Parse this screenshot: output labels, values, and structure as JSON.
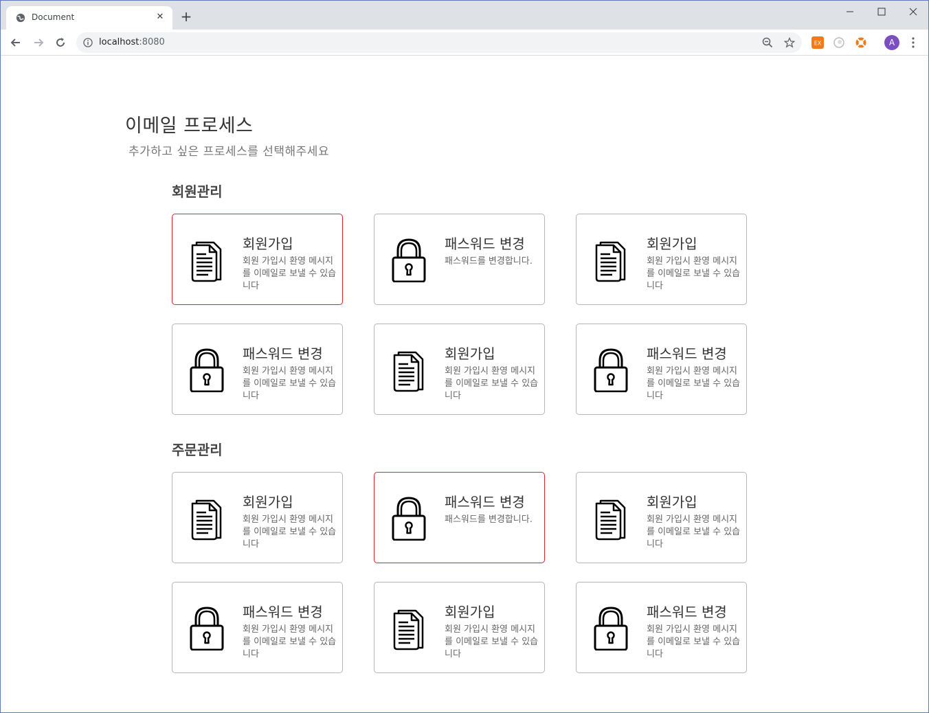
{
  "browser": {
    "tab_title": "Document",
    "url_host": "localhost",
    "url_port": ":8080",
    "avatar_letter": "A",
    "accent": "#7b4fc0"
  },
  "page": {
    "title": "이메일 프로세스",
    "subtitle": "추가하고 싶은 프로세스를 선택해주세요"
  },
  "sections": [
    {
      "title": "회원관리",
      "cards": [
        {
          "title": "회원가입",
          "desc": "회원 가입시 환영 메시지를 이메일로 보낼 수 있습니다",
          "icon": "document-icon",
          "selected": true
        },
        {
          "title": "패스워드 변경",
          "desc": "패스워드를 변경합니다.",
          "icon": "lock-icon",
          "selected": false
        },
        {
          "title": "회원가입",
          "desc": "회원 가입시 환영 메시지를 이메일로 보낼 수 있습니다",
          "icon": "document-icon",
          "selected": false
        },
        {
          "title": "패스워드 변경",
          "desc": "회원 가입시 환영 메시지를 이메일로 보낼 수 있습니다",
          "icon": "lock-icon",
          "selected": false
        },
        {
          "title": "회원가입",
          "desc": "회원 가입시 환영 메시지를 이메일로 보낼 수 있습니다",
          "icon": "document-icon",
          "selected": false
        },
        {
          "title": "패스워드 변경",
          "desc": "회원 가입시 환영 메시지를 이메일로 보낼 수 있습니다",
          "icon": "lock-icon",
          "selected": false
        }
      ]
    },
    {
      "title": "주문관리",
      "cards": [
        {
          "title": "회원가입",
          "desc": "회원 가입시 환영 메시지를 이메일로 보낼 수 있습니다",
          "icon": "document-icon",
          "selected": false
        },
        {
          "title": "패스워드 변경",
          "desc": "패스워드를 변경합니다.",
          "icon": "lock-icon",
          "selected": true
        },
        {
          "title": "회원가입",
          "desc": "회원 가입시 환영 메시지를 이메일로 보낼 수 있습니다",
          "icon": "document-icon",
          "selected": false
        },
        {
          "title": "패스워드 변경",
          "desc": "회원 가입시 환영 메시지를 이메일로 보낼 수 있습니다",
          "icon": "lock-icon",
          "selected": false
        },
        {
          "title": "회원가입",
          "desc": "회원 가입시 환영 메시지를 이메일로 보낼 수 있습니다",
          "icon": "document-icon",
          "selected": false
        },
        {
          "title": "패스워드 변경",
          "desc": "회원 가입시 환영 메시지를 이메일로 보낼 수 있습니다",
          "icon": "lock-icon",
          "selected": false
        }
      ]
    }
  ],
  "colors": {
    "selected_border": "#e0232b",
    "card_border": "#b5b5b5"
  }
}
